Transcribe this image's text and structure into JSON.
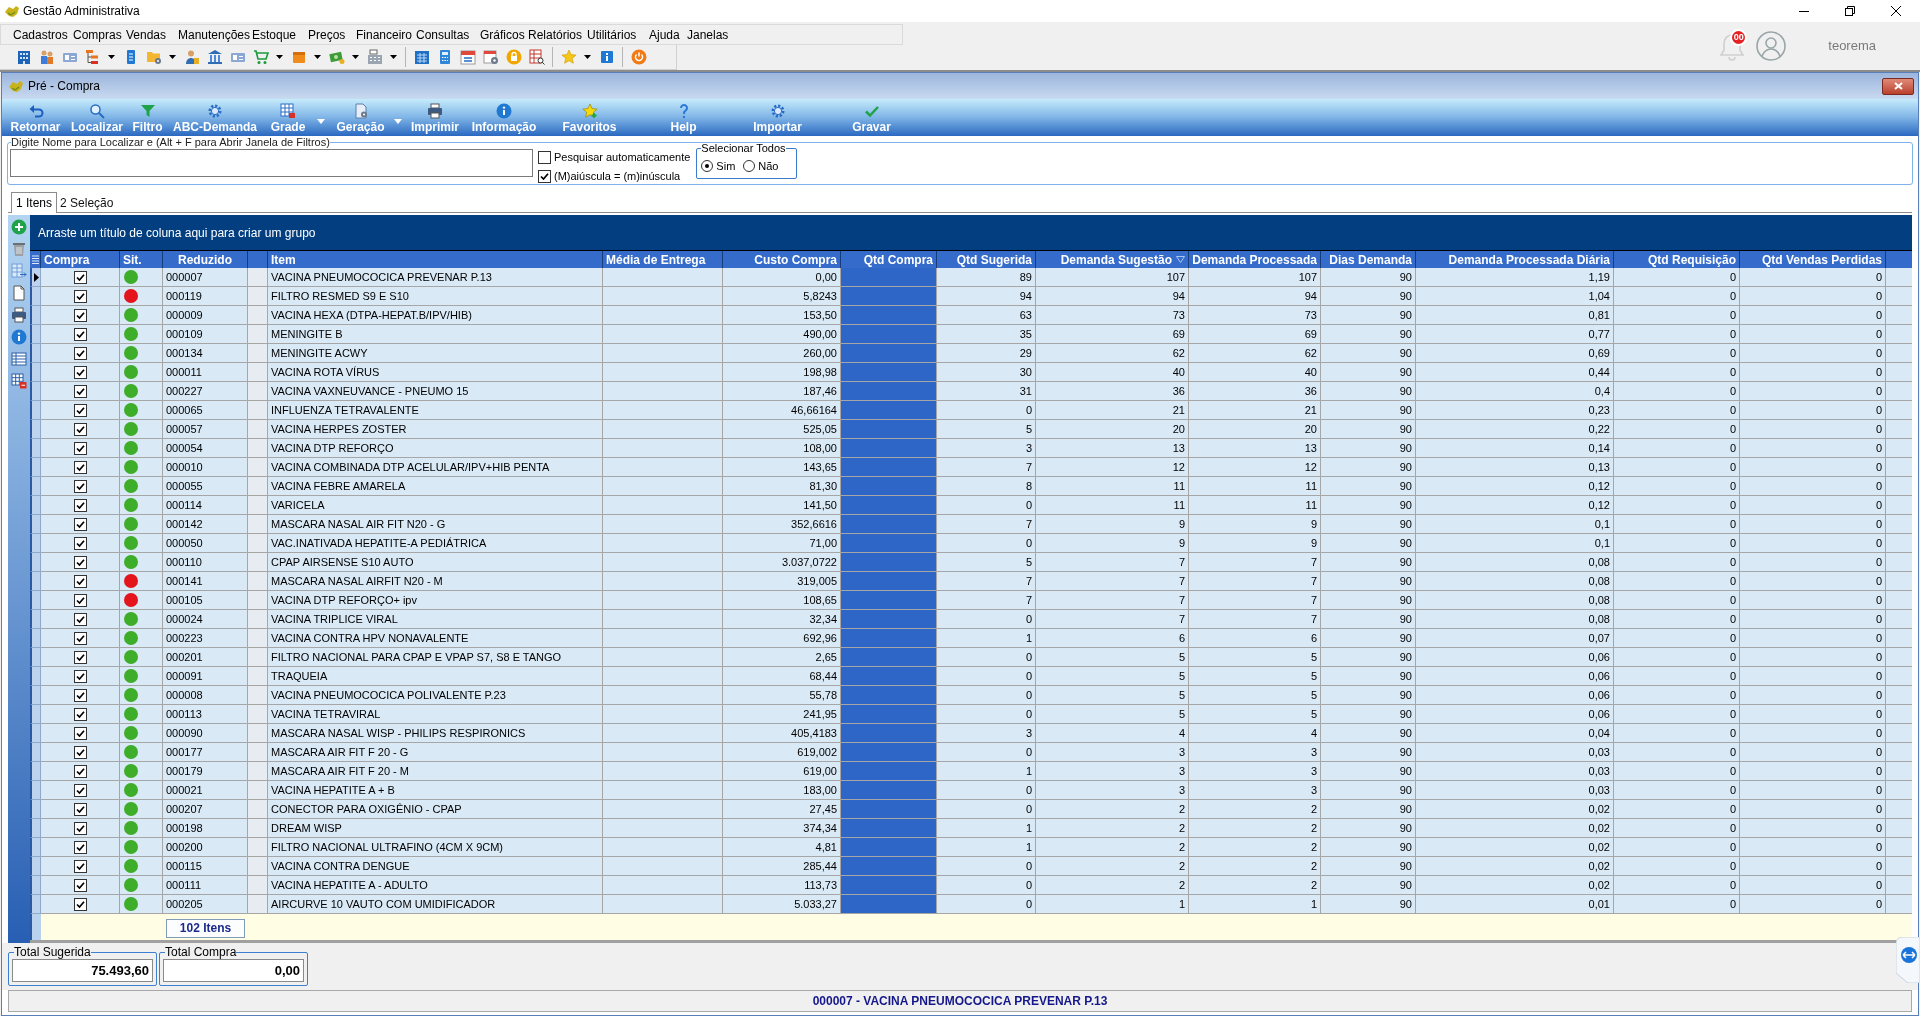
{
  "window": {
    "title": "Gestão Administrativa"
  },
  "menu": [
    "Cadastros",
    "Compras",
    "Vendas",
    "Manutenções",
    "Estoque",
    "Preços",
    "Financeiro",
    "Consultas",
    "Gráficos",
    "Relatórios",
    "Utilitários",
    "Ajuda",
    "Janelas"
  ],
  "account": {
    "notifications": "00",
    "user": "teorema"
  },
  "child_window": {
    "title": "Pré - Compra"
  },
  "actions": [
    {
      "label": "Retornar",
      "dropdown": false
    },
    {
      "label": "Localizar",
      "dropdown": false
    },
    {
      "label": "Filtro",
      "dropdown": false
    },
    {
      "label": "ABC-Demanda",
      "dropdown": false
    },
    {
      "label": "Grade",
      "dropdown": true
    },
    {
      "label": "Geração",
      "dropdown": true
    },
    {
      "label": "Imprimir",
      "dropdown": false
    },
    {
      "label": "Informação",
      "dropdown": false
    },
    {
      "label": "Favoritos",
      "dropdown": false
    },
    {
      "label": "Help",
      "dropdown": false
    },
    {
      "label": "Importar",
      "dropdown": false
    },
    {
      "label": "Gravar",
      "dropdown": false
    }
  ],
  "search": {
    "label": "Digite Nome para Localizar e (Alt + F para Abrir Janela de Filtros)"
  },
  "search_options": [
    {
      "label": "Pesquisar automaticamente",
      "checked": false
    },
    {
      "label": "(M)aiúscula = (m)inúscula",
      "checked": true
    }
  ],
  "select_all": {
    "title": "Selecionar Todos",
    "options": [
      {
        "label": "Sim",
        "selected": true
      },
      {
        "label": "Não",
        "selected": false
      }
    ]
  },
  "tabs": [
    {
      "label": "1 Itens",
      "selected": true
    },
    {
      "label": "2 Seleção",
      "selected": false
    }
  ],
  "grid": {
    "group_hint": "Arraste um título de coluna aqui para criar um grupo",
    "columns": [
      {
        "label": "Compra",
        "kind": "check",
        "sorted_descending": false
      },
      {
        "label": "Sit.",
        "kind": "status",
        "sorted_descending": false
      },
      {
        "label": "Reduzido",
        "kind": "code",
        "sorted_descending": false
      },
      {
        "kind": "blank",
        "sorted_descending": false
      },
      {
        "label": "Item",
        "kind": "text",
        "sorted_descending": false
      },
      {
        "label": "Média de Entrega",
        "kind": "text",
        "sorted_descending": false
      },
      {
        "label": "Custo Compra",
        "kind": "number",
        "sorted_descending": false
      },
      {
        "label": "Qtd Compra",
        "kind": "entry",
        "sorted_descending": false
      },
      {
        "label": "Qtd Sugerida",
        "kind": "number",
        "sorted_descending": false
      },
      {
        "label": "Demanda Sugestão",
        "kind": "number",
        "sorted_descending": true
      },
      {
        "label": "Demanda Processada",
        "kind": "number",
        "sorted_descending": false
      },
      {
        "label": "Dias Demanda",
        "kind": "number",
        "sorted_descending": false
      },
      {
        "label": "Demanda Processada Diária",
        "kind": "number",
        "sorted_descending": false
      },
      {
        "label": "Qtd Requisição",
        "kind": "number",
        "sorted_descending": false
      },
      {
        "label": "Qtd Vendas Perdidas",
        "kind": "number",
        "sorted_descending": false
      }
    ],
    "rows": [
      {
        "selected": true,
        "checked": true,
        "color": "#3dad2a",
        "reduzido": "000007",
        "item": "VACINA PNEUMOCOCICA PREVENAR P.13",
        "custo_compra": "0,00",
        "qtd_sugerida": "89",
        "demanda_sugestao": "107",
        "demanda_processada": "107",
        "dias_demanda": "90",
        "demanda_processada_diaria": "1,19",
        "qtd_requisicao": "0",
        "qtd_vendas_perdidas": "0"
      },
      {
        "selected": false,
        "checked": true,
        "color": "#e3141c",
        "reduzido": "000119",
        "item": "FILTRO RESMED S9 E S10",
        "custo_compra": "5,8243",
        "qtd_sugerida": "94",
        "demanda_sugestao": "94",
        "demanda_processada": "94",
        "dias_demanda": "90",
        "demanda_processada_diaria": "1,04",
        "qtd_requisicao": "0",
        "qtd_vendas_perdidas": "0"
      },
      {
        "selected": false,
        "checked": true,
        "color": "#3dad2a",
        "reduzido": "000009",
        "item": "VACINA HEXA (DTPA-HEPAT.B/IPV/HIB)",
        "custo_compra": "153,50",
        "qtd_sugerida": "63",
        "demanda_sugestao": "73",
        "demanda_processada": "73",
        "dias_demanda": "90",
        "demanda_processada_diaria": "0,81",
        "qtd_requisicao": "0",
        "qtd_vendas_perdidas": "0"
      },
      {
        "selected": false,
        "checked": true,
        "color": "#3dad2a",
        "reduzido": "000109",
        "item": "MENINGITE B",
        "custo_compra": "490,00",
        "qtd_sugerida": "35",
        "demanda_sugestao": "69",
        "demanda_processada": "69",
        "dias_demanda": "90",
        "demanda_processada_diaria": "0,77",
        "qtd_requisicao": "0",
        "qtd_vendas_perdidas": "0"
      },
      {
        "selected": false,
        "checked": true,
        "color": "#3dad2a",
        "reduzido": "000134",
        "item": "MENINGITE ACWY",
        "custo_compra": "260,00",
        "qtd_sugerida": "29",
        "demanda_sugestao": "62",
        "demanda_processada": "62",
        "dias_demanda": "90",
        "demanda_processada_diaria": "0,69",
        "qtd_requisicao": "0",
        "qtd_vendas_perdidas": "0"
      },
      {
        "selected": false,
        "checked": true,
        "color": "#3dad2a",
        "reduzido": "000011",
        "item": "VACINA ROTA VÍRUS",
        "custo_compra": "198,98",
        "qtd_sugerida": "30",
        "demanda_sugestao": "40",
        "demanda_processada": "40",
        "dias_demanda": "90",
        "demanda_processada_diaria": "0,44",
        "qtd_requisicao": "0",
        "qtd_vendas_perdidas": "0"
      },
      {
        "selected": false,
        "checked": true,
        "color": "#3dad2a",
        "reduzido": "000227",
        "item": "VACINA VAXNEUVANCE - PNEUMO 15",
        "custo_compra": "187,46",
        "qtd_sugerida": "31",
        "demanda_sugestao": "36",
        "demanda_processada": "36",
        "dias_demanda": "90",
        "demanda_processada_diaria": "0,4",
        "qtd_requisicao": "0",
        "qtd_vendas_perdidas": "0"
      },
      {
        "selected": false,
        "checked": true,
        "color": "#3dad2a",
        "reduzido": "000065",
        "item": "INFLUENZA TETRAVALENTE",
        "custo_compra": "46,66164",
        "qtd_sugerida": "0",
        "demanda_sugestao": "21",
        "demanda_processada": "21",
        "dias_demanda": "90",
        "demanda_processada_diaria": "0,23",
        "qtd_requisicao": "0",
        "qtd_vendas_perdidas": "0"
      },
      {
        "selected": false,
        "checked": true,
        "color": "#3dad2a",
        "reduzido": "000057",
        "item": "VACINA HERPES ZOSTER",
        "custo_compra": "525,05",
        "qtd_sugerida": "5",
        "demanda_sugestao": "20",
        "demanda_processada": "20",
        "dias_demanda": "90",
        "demanda_processada_diaria": "0,22",
        "qtd_requisicao": "0",
        "qtd_vendas_perdidas": "0"
      },
      {
        "selected": false,
        "checked": true,
        "color": "#3dad2a",
        "reduzido": "000054",
        "item": "VACINA DTP REFORÇO",
        "custo_compra": "108,00",
        "qtd_sugerida": "3",
        "demanda_sugestao": "13",
        "demanda_processada": "13",
        "dias_demanda": "90",
        "demanda_processada_diaria": "0,14",
        "qtd_requisicao": "0",
        "qtd_vendas_perdidas": "0"
      },
      {
        "selected": false,
        "checked": true,
        "color": "#3dad2a",
        "reduzido": "000010",
        "item": "VACINA COMBINADA DTP ACELULAR/IPV+HIB PENTA",
        "custo_compra": "143,65",
        "qtd_sugerida": "7",
        "demanda_sugestao": "12",
        "demanda_processada": "12",
        "dias_demanda": "90",
        "demanda_processada_diaria": "0,13",
        "qtd_requisicao": "0",
        "qtd_vendas_perdidas": "0"
      },
      {
        "selected": false,
        "checked": true,
        "color": "#3dad2a",
        "reduzido": "000055",
        "item": "VACINA FEBRE AMARELA",
        "custo_compra": "81,30",
        "qtd_sugerida": "8",
        "demanda_sugestao": "11",
        "demanda_processada": "11",
        "dias_demanda": "90",
        "demanda_processada_diaria": "0,12",
        "qtd_requisicao": "0",
        "qtd_vendas_perdidas": "0"
      },
      {
        "selected": false,
        "checked": true,
        "color": "#3dad2a",
        "reduzido": "000114",
        "item": "VARICELA",
        "custo_compra": "141,50",
        "qtd_sugerida": "0",
        "demanda_sugestao": "11",
        "demanda_processada": "11",
        "dias_demanda": "90",
        "demanda_processada_diaria": "0,12",
        "qtd_requisicao": "0",
        "qtd_vendas_perdidas": "0"
      },
      {
        "selected": false,
        "checked": true,
        "color": "#3dad2a",
        "reduzido": "000142",
        "item": "MASCARA NASAL AIR FIT N20 - G",
        "custo_compra": "352,6616",
        "qtd_sugerida": "7",
        "demanda_sugestao": "9",
        "demanda_processada": "9",
        "dias_demanda": "90",
        "demanda_processada_diaria": "0,1",
        "qtd_requisicao": "0",
        "qtd_vendas_perdidas": "0"
      },
      {
        "selected": false,
        "checked": true,
        "color": "#3dad2a",
        "reduzido": "000050",
        "item": "VAC.INATIVADA HEPATITE-A PEDIÁTRICA",
        "custo_compra": "71,00",
        "qtd_sugerida": "0",
        "demanda_sugestao": "9",
        "demanda_processada": "9",
        "dias_demanda": "90",
        "demanda_processada_diaria": "0,1",
        "qtd_requisicao": "0",
        "qtd_vendas_perdidas": "0"
      },
      {
        "selected": false,
        "checked": true,
        "color": "#3dad2a",
        "reduzido": "000110",
        "item": "CPAP AIRSENSE S10 AUTO",
        "custo_compra": "3.037,0722",
        "qtd_sugerida": "5",
        "demanda_sugestao": "7",
        "demanda_processada": "7",
        "dias_demanda": "90",
        "demanda_processada_diaria": "0,08",
        "qtd_requisicao": "0",
        "qtd_vendas_perdidas": "0"
      },
      {
        "selected": false,
        "checked": true,
        "color": "#e3141c",
        "reduzido": "000141",
        "item": "MASCARA NASAL AIRFIT N20 - M",
        "custo_compra": "319,005",
        "qtd_sugerida": "7",
        "demanda_sugestao": "7",
        "demanda_processada": "7",
        "dias_demanda": "90",
        "demanda_processada_diaria": "0,08",
        "qtd_requisicao": "0",
        "qtd_vendas_perdidas": "0"
      },
      {
        "selected": false,
        "checked": true,
        "color": "#e3141c",
        "reduzido": "000105",
        "item": "VACINA DTP REFORÇO+ ipv",
        "custo_compra": "108,65",
        "qtd_sugerida": "7",
        "demanda_sugestao": "7",
        "demanda_processada": "7",
        "dias_demanda": "90",
        "demanda_processada_diaria": "0,08",
        "qtd_requisicao": "0",
        "qtd_vendas_perdidas": "0"
      },
      {
        "selected": false,
        "checked": true,
        "color": "#3dad2a",
        "reduzido": "000024",
        "item": "VACINA TRIPLICE VIRAL",
        "custo_compra": "32,34",
        "qtd_sugerida": "0",
        "demanda_sugestao": "7",
        "demanda_processada": "7",
        "dias_demanda": "90",
        "demanda_processada_diaria": "0,08",
        "qtd_requisicao": "0",
        "qtd_vendas_perdidas": "0"
      },
      {
        "selected": false,
        "checked": true,
        "color": "#3dad2a",
        "reduzido": "000223",
        "item": "VACINA CONTRA HPV NONAVALENTE",
        "custo_compra": "692,96",
        "qtd_sugerida": "1",
        "demanda_sugestao": "6",
        "demanda_processada": "6",
        "dias_demanda": "90",
        "demanda_processada_diaria": "0,07",
        "qtd_requisicao": "0",
        "qtd_vendas_perdidas": "0"
      },
      {
        "selected": false,
        "checked": true,
        "color": "#3dad2a",
        "reduzido": "000201",
        "item": "FILTRO NACIONAL PARA CPAP E VPAP S7, S8 E TANGO",
        "custo_compra": "2,65",
        "qtd_sugerida": "0",
        "demanda_sugestao": "5",
        "demanda_processada": "5",
        "dias_demanda": "90",
        "demanda_processada_diaria": "0,06",
        "qtd_requisicao": "0",
        "qtd_vendas_perdidas": "0"
      },
      {
        "selected": false,
        "checked": true,
        "color": "#3dad2a",
        "reduzido": "000091",
        "item": "TRAQUEIA",
        "custo_compra": "68,44",
        "qtd_sugerida": "0",
        "demanda_sugestao": "5",
        "demanda_processada": "5",
        "dias_demanda": "90",
        "demanda_processada_diaria": "0,06",
        "qtd_requisicao": "0",
        "qtd_vendas_perdidas": "0"
      },
      {
        "selected": false,
        "checked": true,
        "color": "#3dad2a",
        "reduzido": "000008",
        "item": "VACINA PNEUMOCOCICA POLIVALENTE P.23",
        "custo_compra": "55,78",
        "qtd_sugerida": "0",
        "demanda_sugestao": "5",
        "demanda_processada": "5",
        "dias_demanda": "90",
        "demanda_processada_diaria": "0,06",
        "qtd_requisicao": "0",
        "qtd_vendas_perdidas": "0"
      },
      {
        "selected": false,
        "checked": true,
        "color": "#3dad2a",
        "reduzido": "000113",
        "item": "VACINA TETRAVIRAL",
        "custo_compra": "241,95",
        "qtd_sugerida": "0",
        "demanda_sugestao": "5",
        "demanda_processada": "5",
        "dias_demanda": "90",
        "demanda_processada_diaria": "0,06",
        "qtd_requisicao": "0",
        "qtd_vendas_perdidas": "0"
      },
      {
        "selected": false,
        "checked": true,
        "color": "#3dad2a",
        "reduzido": "000090",
        "item": "MASCARA NASAL WISP - PHILIPS RESPIRONICS",
        "custo_compra": "405,4183",
        "qtd_sugerida": "3",
        "demanda_sugestao": "4",
        "demanda_processada": "4",
        "dias_demanda": "90",
        "demanda_processada_diaria": "0,04",
        "qtd_requisicao": "0",
        "qtd_vendas_perdidas": "0"
      },
      {
        "selected": false,
        "checked": true,
        "color": "#3dad2a",
        "reduzido": "000177",
        "item": "MASCARA AIR FIT F 20 - G",
        "custo_compra": "619,002",
        "qtd_sugerida": "0",
        "demanda_sugestao": "3",
        "demanda_processada": "3",
        "dias_demanda": "90",
        "demanda_processada_diaria": "0,03",
        "qtd_requisicao": "0",
        "qtd_vendas_perdidas": "0"
      },
      {
        "selected": false,
        "checked": true,
        "color": "#3dad2a",
        "reduzido": "000179",
        "item": "MASCARA AIR FIT F 20 - M",
        "custo_compra": "619,00",
        "qtd_sugerida": "1",
        "demanda_sugestao": "3",
        "demanda_processada": "3",
        "dias_demanda": "90",
        "demanda_processada_diaria": "0,03",
        "qtd_requisicao": "0",
        "qtd_vendas_perdidas": "0"
      },
      {
        "selected": false,
        "checked": true,
        "color": "#3dad2a",
        "reduzido": "000021",
        "item": "VACINA HEPATITE A + B",
        "custo_compra": "183,00",
        "qtd_sugerida": "0",
        "demanda_sugestao": "3",
        "demanda_processada": "3",
        "dias_demanda": "90",
        "demanda_processada_diaria": "0,03",
        "qtd_requisicao": "0",
        "qtd_vendas_perdidas": "0"
      },
      {
        "selected": false,
        "checked": true,
        "color": "#3dad2a",
        "reduzido": "000207",
        "item": "CONECTOR PARA OXIGÊNIO - CPAP",
        "custo_compra": "27,45",
        "qtd_sugerida": "0",
        "demanda_sugestao": "2",
        "demanda_processada": "2",
        "dias_demanda": "90",
        "demanda_processada_diaria": "0,02",
        "qtd_requisicao": "0",
        "qtd_vendas_perdidas": "0"
      },
      {
        "selected": false,
        "checked": true,
        "color": "#3dad2a",
        "reduzido": "000198",
        "item": "DREAM WISP",
        "custo_compra": "374,34",
        "qtd_sugerida": "1",
        "demanda_sugestao": "2",
        "demanda_processada": "2",
        "dias_demanda": "90",
        "demanda_processada_diaria": "0,02",
        "qtd_requisicao": "0",
        "qtd_vendas_perdidas": "0"
      },
      {
        "selected": false,
        "checked": true,
        "color": "#3dad2a",
        "reduzido": "000200",
        "item": "FILTRO NACIONAL ULTRAFINO (4CM X 9CM)",
        "custo_compra": "4,81",
        "qtd_sugerida": "1",
        "demanda_sugestao": "2",
        "demanda_processada": "2",
        "dias_demanda": "90",
        "demanda_processada_diaria": "0,02",
        "qtd_requisicao": "0",
        "qtd_vendas_perdidas": "0"
      },
      {
        "selected": false,
        "checked": true,
        "color": "#3dad2a",
        "reduzido": "000115",
        "item": "VACINA CONTRA DENGUE",
        "custo_compra": "285,44",
        "qtd_sugerida": "0",
        "demanda_sugestao": "2",
        "demanda_processada": "2",
        "dias_demanda": "90",
        "demanda_processada_diaria": "0,02",
        "qtd_requisicao": "0",
        "qtd_vendas_perdidas": "0"
      },
      {
        "selected": false,
        "checked": true,
        "color": "#3dad2a",
        "reduzido": "000111",
        "item": "VACINA HEPATITE A - ADULTO",
        "custo_compra": "113,73",
        "qtd_sugerida": "0",
        "demanda_sugestao": "2",
        "demanda_processada": "2",
        "dias_demanda": "90",
        "demanda_processada_diaria": "0,02",
        "qtd_requisicao": "0",
        "qtd_vendas_perdidas": "0"
      },
      {
        "selected": false,
        "checked": true,
        "color": "#3dad2a",
        "reduzido": "000205",
        "item": "AIRCURVE 10 VAUTO COM UMIDIFICADOR",
        "custo_compra": "5.033,27",
        "qtd_sugerida": "0",
        "demanda_sugestao": "1",
        "demanda_processada": "1",
        "dias_demanda": "90",
        "demanda_processada_diaria": "0,01",
        "qtd_requisicao": "0",
        "qtd_vendas_perdidas": "0"
      }
    ],
    "footer": "102 Itens"
  },
  "totals": [
    {
      "label": "Total Sugerida",
      "value": "75.493,60"
    },
    {
      "label": "Total Compra",
      "value": "0,00"
    }
  ],
  "status_bar": "000007 - VACINA PNEUMOCOCICA PREVENAR P.13"
}
